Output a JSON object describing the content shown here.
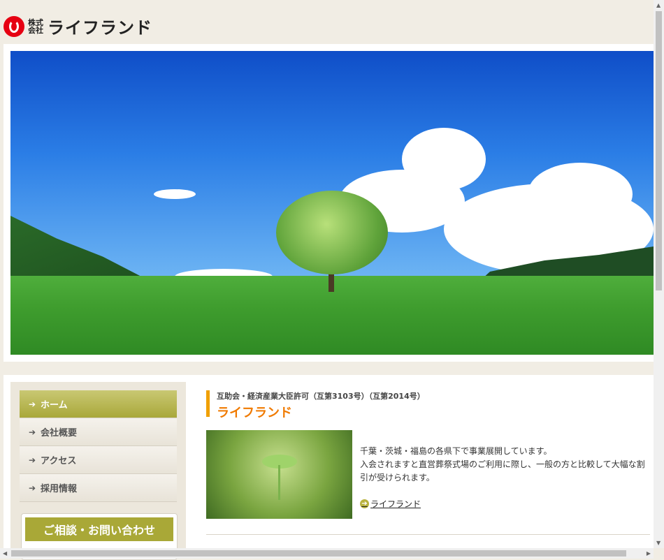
{
  "header": {
    "logo_small": "株式会社",
    "logo_name": "ライフランド"
  },
  "nav": {
    "items": [
      {
        "label": "ホーム"
      },
      {
        "label": "会社概要"
      },
      {
        "label": "アクセス"
      },
      {
        "label": "採用情報"
      }
    ],
    "arrow": "➔"
  },
  "contact": {
    "label": "ご相談・お問い合わせ"
  },
  "content": {
    "subtitle": "互助会・経済産業大臣許可（互第3103号）（互第2014号）",
    "title": "ライフランド",
    "description_1": "千葉・茨城・福島の各県下で事業展開しています。",
    "description_2": "入会されますと直営葬祭式場のご利用に際し、一般の方と比較して大幅な割引が受けられます。",
    "link": "ライフランド"
  }
}
